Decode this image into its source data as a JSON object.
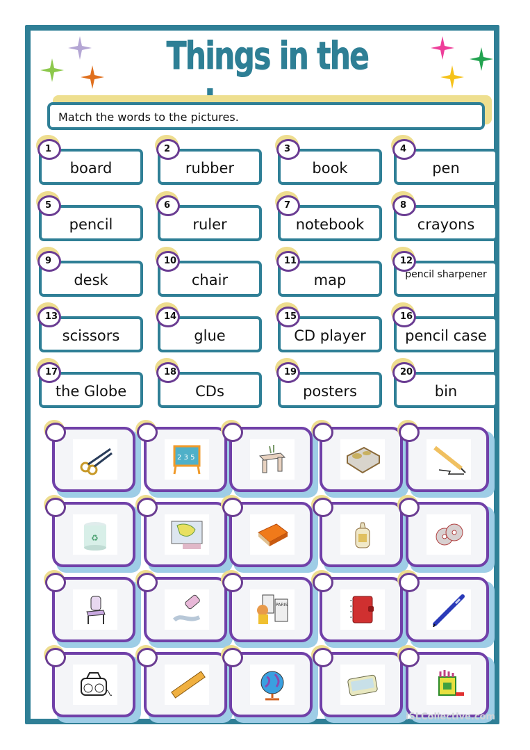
{
  "title": "Things in the classroom",
  "instruction": "Match the words to the pictures.",
  "colors": {
    "frame": "#2f7f96",
    "title": "#2e7f95",
    "card_border": "#7040a8",
    "circle_border": "#6a3c92",
    "glow": "#eedd8f"
  },
  "words": [
    {
      "num": "1",
      "label": "board"
    },
    {
      "num": "2",
      "label": "rubber"
    },
    {
      "num": "3",
      "label": "book"
    },
    {
      "num": "4",
      "label": "pen"
    },
    {
      "num": "5",
      "label": "pencil"
    },
    {
      "num": "6",
      "label": "ruler"
    },
    {
      "num": "7",
      "label": "notebook"
    },
    {
      "num": "8",
      "label": "crayons"
    },
    {
      "num": "9",
      "label": "desk"
    },
    {
      "num": "10",
      "label": "chair"
    },
    {
      "num": "11",
      "label": "map"
    },
    {
      "num": "12",
      "label": "pencil sharpener"
    },
    {
      "num": "13",
      "label": "scissors"
    },
    {
      "num": "14",
      "label": "glue"
    },
    {
      "num": "15",
      "label": "CD player"
    },
    {
      "num": "16",
      "label": "pencil case"
    },
    {
      "num": "17",
      "label": "the Globe"
    },
    {
      "num": "18",
      "label": "CDs"
    },
    {
      "num": "19",
      "label": "posters"
    },
    {
      "num": "20",
      "label": "bin"
    }
  ],
  "pictures": [
    "scissors-icon",
    "board-icon",
    "desk-icon",
    "pencil-sharpener-icon",
    "pencil-icon",
    "bin-icon",
    "map-icon",
    "book-icon",
    "glue-icon",
    "cds-icon",
    "chair-icon",
    "rubber-icon",
    "posters-icon",
    "notebook-icon",
    "pen-icon",
    "cd-player-icon",
    "ruler-icon",
    "globe-icon",
    "pencil-case-icon",
    "crayons-icon"
  ],
  "watermark": "iSLCollective.com"
}
